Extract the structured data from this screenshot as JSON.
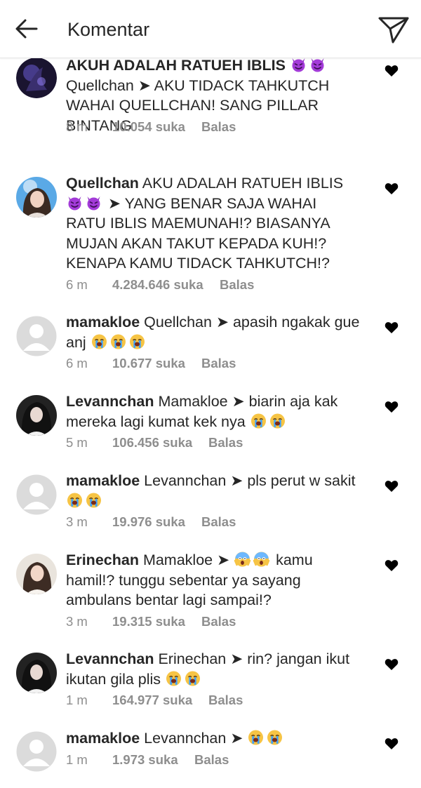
{
  "header": {
    "title": "Komentar",
    "back_icon": "arrow-left-icon",
    "share_icon": "send-icon"
  },
  "colors": {
    "text": "#262626",
    "meta": "#8e8e8e",
    "divider": "#e6e6e6"
  },
  "comments": [
    {
      "username": "AKUH ADALAH RATUEH IBLIS",
      "user_emoji": [
        "smiling-devil",
        "smiling-devil"
      ],
      "mention": "Quellchan",
      "arrow": "➤",
      "body": "AKU TIDACK TAHKUTCH WAHAI QUELLCHAN! SANG PILLAR BINTANG",
      "time": "8 m",
      "likes": "10.054 suka",
      "reply": "Balas",
      "avatar": "purple-dark"
    },
    {
      "username": "Quellchan",
      "mention": "AKU ADALAH RATUEH IBLIS",
      "mention_emoji": [
        "smiling-devil",
        "smiling-devil"
      ],
      "arrow": "➤",
      "body": "YANG BENAR SAJA WAHAI RATU IBLIS MAEMUNAH!? BIASANYA MUJAN AKAN TAKUT KEPADA KUH!? KENAPA KAMU TIDACK TAHKUTCH!?",
      "time": "6 m",
      "likes": "4.284.646 suka",
      "reply": "Balas",
      "avatar": "girl-blue"
    },
    {
      "username": "mamakloe",
      "mention": "Quellchan",
      "arrow": "➤",
      "body": "apasih ngakak gue anj",
      "body_emoji": [
        "loudly-crying",
        "loudly-crying",
        "loudly-crying"
      ],
      "time": "6 m",
      "likes": "10.677 suka",
      "reply": "Balas",
      "avatar": "default"
    },
    {
      "username": "Levannchan",
      "mention": "Mamakloe",
      "arrow": "➤",
      "body": "biarin aja kak mereka lagi kumat kek nya",
      "body_emoji": [
        "loudly-crying",
        "loudly-crying"
      ],
      "time": "5 m",
      "likes": "106.456 suka",
      "reply": "Balas",
      "avatar": "girl-dark"
    },
    {
      "username": "mamakloe",
      "mention": "Levannchan",
      "arrow": "➤",
      "body": "pls perut w sakit",
      "body_emoji": [
        "loudly-crying",
        "loudly-crying"
      ],
      "time": "3 m",
      "likes": "19.976 suka",
      "reply": "Balas",
      "avatar": "default"
    },
    {
      "username": "Erinechan",
      "mention": "Mamakloe",
      "arrow": "➤",
      "lead_emoji": [
        "screaming-in-fear",
        "screaming-in-fear"
      ],
      "body": "kamu hamil!? tunggu sebentar ya sayang ambulans bentar lagi sampai!?",
      "time": "3 m",
      "likes": "19.315 suka",
      "reply": "Balas",
      "avatar": "girl-light"
    },
    {
      "username": "Levannchan",
      "mention": "Erinechan",
      "arrow": "➤",
      "body": "rin? jangan ikut ikutan gila plis",
      "body_emoji": [
        "loudly-crying",
        "loudly-crying"
      ],
      "time": "1 m",
      "likes": "164.977 suka",
      "reply": "Balas",
      "avatar": "girl-dark"
    },
    {
      "username": "mamakloe",
      "mention": "Levannchan",
      "arrow": "➤",
      "body": "",
      "body_emoji": [
        "loudly-crying",
        "loudly-crying"
      ],
      "time": "1 m",
      "likes": "1.973 suka",
      "reply": "Balas",
      "avatar": "default"
    }
  ]
}
